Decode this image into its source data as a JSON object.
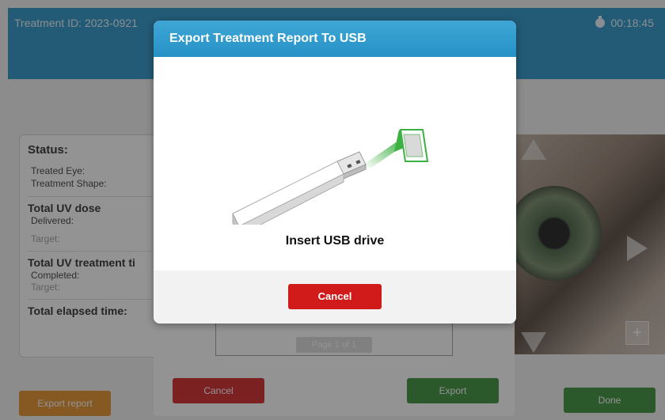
{
  "header": {
    "treatment_id": "Treatment ID: 2023-0921",
    "timer": "00:18:45"
  },
  "status": {
    "title": "Status:",
    "treated_eye": "Treated Eye:",
    "treatment_shape": "Treatment Shape:",
    "uv_dose_title": "Total UV dose",
    "delivered": "Delivered:",
    "target1": "Target:",
    "uv_time_title": "Total UV treatment ti",
    "completed": "Completed:",
    "target2": "Target:",
    "elapsed_title": "Total elapsed time:"
  },
  "background_buttons": {
    "export_report": "Export report",
    "done": "Done",
    "cancel": "Cancel",
    "export": "Export",
    "page": "Page 1 of 1"
  },
  "eye_panel": {
    "plus": "+"
  },
  "modal": {
    "title": "Export Treatment Report To USB",
    "message": "Insert USB drive",
    "cancel_label": "Cancel"
  },
  "colors": {
    "header_blue": "#1f8fc4",
    "cancel_red": "#d11b1b",
    "export_green": "#2e8b2e",
    "export_orange": "#e58a1f",
    "arrow_green": "#3cb043"
  },
  "icons": [
    "timer-icon",
    "usb-drive-icon",
    "usb-port-icon",
    "arrow-up-icon",
    "arrow-right-icon",
    "arrow-down-icon",
    "plus-icon"
  ]
}
